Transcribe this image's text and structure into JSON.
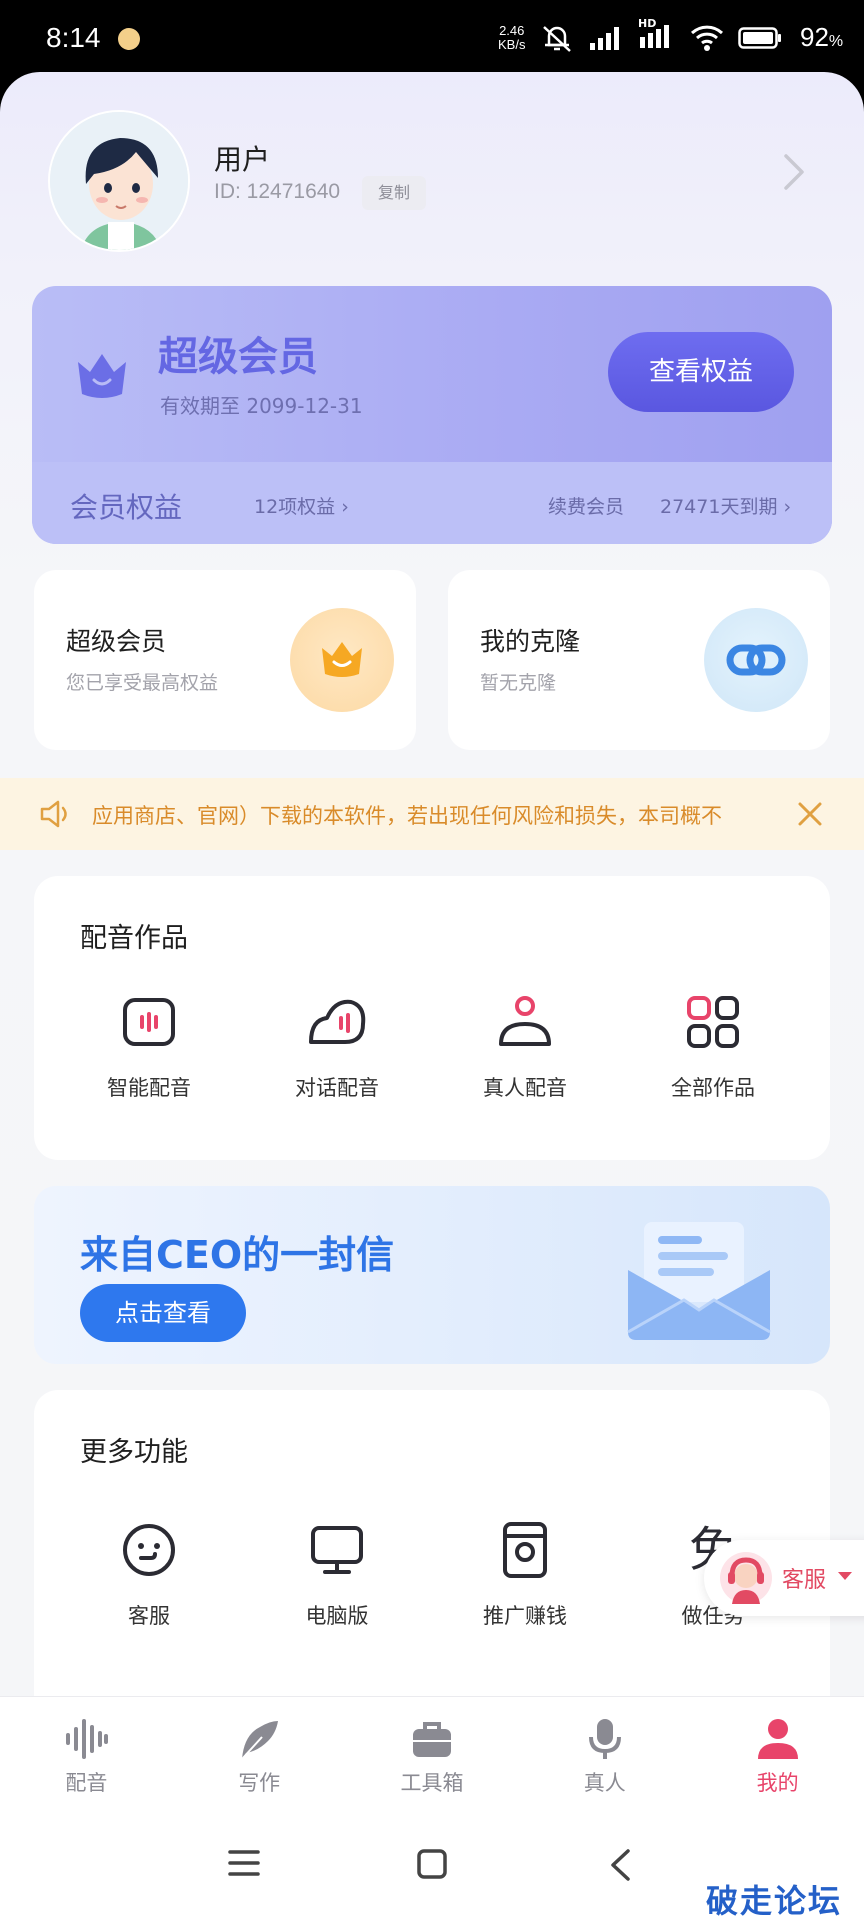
{
  "status_bar": {
    "time": "8:14",
    "net_speed_value": "2.46",
    "net_speed_unit": "KB/s",
    "hd_label": "HD",
    "battery": "92",
    "battery_unit": "%"
  },
  "profile": {
    "name": "用户",
    "id_text": "ID: 12471640",
    "copy_label": "复制"
  },
  "vip_card": {
    "title": "超级会员",
    "expire": "有效期至 2099-12-31",
    "benefits_button": "查看权益",
    "rights_label": "会员权益",
    "rights_count": "12项权益 ›",
    "renew_label": "续费会员",
    "days_left": "27471天到期 ›"
  },
  "feature_cards": [
    {
      "title": "超级会员",
      "subtitle": "您已享受最高权益"
    },
    {
      "title": "我的克隆",
      "subtitle": "暂无克隆"
    }
  ],
  "notice": {
    "text": "应用商店、官网）下载的本软件，若出现任何风险和损失，本司概不"
  },
  "works": {
    "title": "配音作品",
    "items": [
      {
        "label": "智能配音",
        "icon": "smart-dubbing-icon"
      },
      {
        "label": "对话配音",
        "icon": "dialogue-dubbing-icon"
      },
      {
        "label": "真人配音",
        "icon": "human-dubbing-icon"
      },
      {
        "label": "全部作品",
        "icon": "all-works-icon"
      }
    ]
  },
  "ceo_banner": {
    "title": "来自CEO的一封信",
    "button": "点击查看"
  },
  "more_functions": {
    "title": "更多功能",
    "items": [
      {
        "label": "客服",
        "icon": "customer-service-icon"
      },
      {
        "label": "电脑版",
        "icon": "desktop-icon"
      },
      {
        "label": "推广赚钱",
        "icon": "promote-icon"
      },
      {
        "label": "做任务",
        "icon": "task-icon",
        "glyph": "免"
      }
    ]
  },
  "float_service": {
    "label": "客服"
  },
  "tab_bar": {
    "tabs": [
      {
        "label": "配音",
        "icon": "waveform-icon",
        "active": false
      },
      {
        "label": "写作",
        "icon": "feather-icon",
        "active": false
      },
      {
        "label": "工具箱",
        "icon": "toolbox-icon",
        "active": false
      },
      {
        "label": "真人",
        "icon": "microphone-icon",
        "active": false
      },
      {
        "label": "我的",
        "icon": "person-icon",
        "active": true
      }
    ]
  },
  "watermark": "破走论坛",
  "colors": {
    "accent_pink": "#e8446a",
    "vip_purple": "#6467e3",
    "ceo_blue": "#2e78ee",
    "notice_orange": "#d98b2a"
  }
}
